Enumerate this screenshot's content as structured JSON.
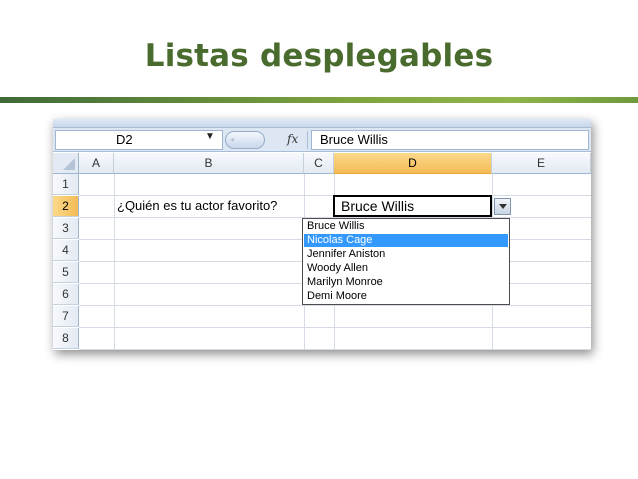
{
  "slide": {
    "title": "Listas desplegables"
  },
  "formula_bar": {
    "name_box": "D2",
    "fx_label": "fx",
    "formula_value": "Bruce Willis"
  },
  "columns": [
    "A",
    "B",
    "C",
    "D",
    "E"
  ],
  "selected_column": "D",
  "rows": [
    "1",
    "2",
    "3",
    "4",
    "5",
    "6",
    "7",
    "8"
  ],
  "selected_row": "2",
  "cells": {
    "B2": "¿Quién es tu actor favorito?",
    "D2": "Bruce Willis"
  },
  "dropdown": {
    "items": [
      "Bruce Willis",
      "Nicolas Cage",
      "Jennifer Aniston",
      "Woody Allen",
      "Marilyn Monroe",
      "Demi Moore"
    ],
    "highlighted_index": 1
  },
  "colors": {
    "title_green": "#4a6b2e",
    "selection_orange": "#f4bb56",
    "highlight_blue": "#3399ff"
  },
  "icons": {
    "name_box_dropdown": "chevron-down-icon",
    "formula_function": "fx-icon",
    "select_all": "select-all-triangle-icon",
    "cell_dropdown": "chevron-down-icon"
  }
}
